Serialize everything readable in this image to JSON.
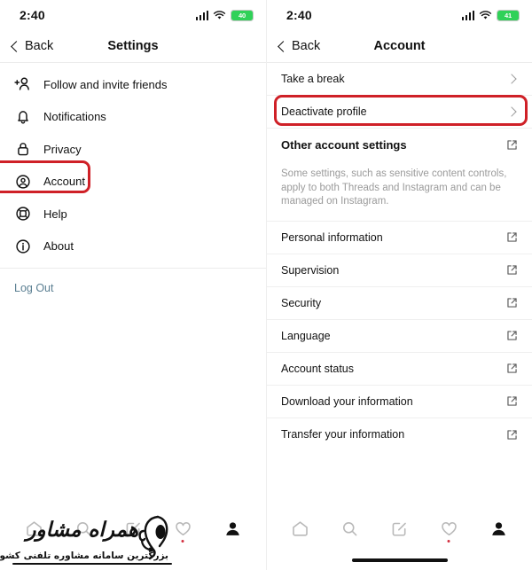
{
  "left": {
    "status": {
      "time": "2:40",
      "battery_percent": "40",
      "battery_label": "40",
      "signal_icon": "cellular-signal-icon",
      "wifi_icon": "wifi-icon",
      "battery_icon": "battery-icon"
    },
    "nav": {
      "back_label": "Back",
      "title": "Settings",
      "back_icon": "chevron-left-icon"
    },
    "items": [
      {
        "label": "Follow and invite friends",
        "icon": "add-person-icon"
      },
      {
        "label": "Notifications",
        "icon": "bell-icon"
      },
      {
        "label": "Privacy",
        "icon": "lock-icon"
      },
      {
        "label": "Account",
        "icon": "account-circle-icon"
      },
      {
        "label": "Help",
        "icon": "lifebuoy-icon"
      },
      {
        "label": "About",
        "icon": "info-circle-icon"
      }
    ],
    "logout_label": "Log Out",
    "highlight_target": "Account",
    "highlight_color": "#cf2027"
  },
  "right": {
    "status": {
      "time": "2:40",
      "battery_percent": "41",
      "battery_label": "41",
      "signal_icon": "cellular-signal-icon",
      "wifi_icon": "wifi-icon",
      "battery_icon": "battery-icon"
    },
    "nav": {
      "back_label": "Back",
      "title": "Account",
      "back_icon": "chevron-left-icon"
    },
    "rows": [
      {
        "label": "Take a break",
        "accessory": "chevron"
      },
      {
        "label": "Deactivate profile",
        "accessory": "chevron"
      },
      {
        "label": "Other account settings",
        "accessory": "external",
        "bold": true
      }
    ],
    "note": "Some settings, such as sensitive content controls, apply to both Threads and Instagram and can be managed on Instagram.",
    "link_rows": [
      {
        "label": "Personal information",
        "accessory": "external"
      },
      {
        "label": "Supervision",
        "accessory": "external"
      },
      {
        "label": "Security",
        "accessory": "external"
      },
      {
        "label": "Language",
        "accessory": "external"
      },
      {
        "label": "Account status",
        "accessory": "external"
      },
      {
        "label": "Download your information",
        "accessory": "external"
      },
      {
        "label": "Transfer your information",
        "accessory": "external"
      }
    ],
    "highlight_target": "Deactivate profile",
    "highlight_color": "#cf2027"
  },
  "tabbar": {
    "tabs": [
      {
        "icon": "home-icon",
        "name": "home"
      },
      {
        "icon": "search-icon",
        "name": "search"
      },
      {
        "icon": "compose-icon",
        "name": "compose"
      },
      {
        "icon": "heart-icon",
        "name": "activity",
        "badge": true
      },
      {
        "icon": "profile-icon",
        "name": "profile",
        "active": true
      }
    ]
  },
  "watermark": {
    "title": "همراه مشاور",
    "subtitle": "بزرگترین سامانه مشاوره تلفنی کشور"
  }
}
